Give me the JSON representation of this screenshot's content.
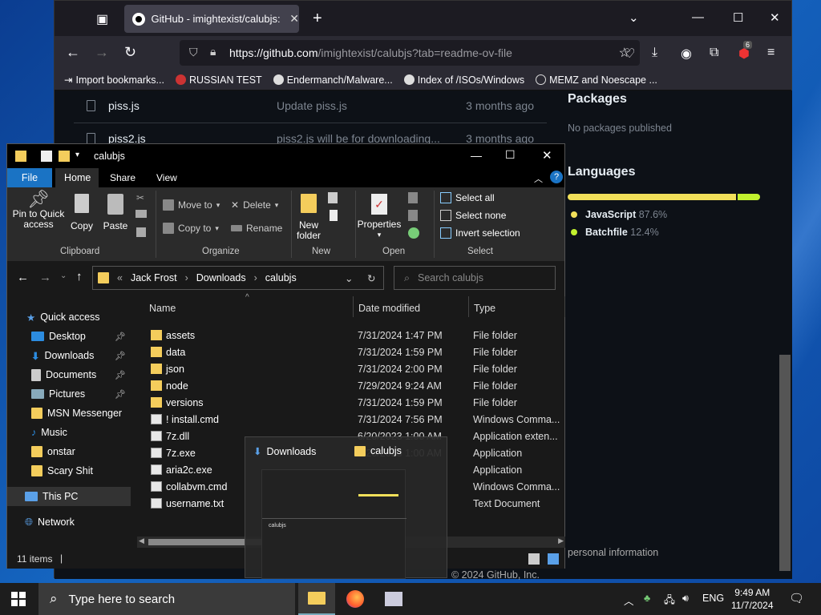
{
  "browser": {
    "tab_title": "GitHub - imightexist/calubjs: th",
    "url_host": "https://github.com",
    "url_path": "/imightexist/calubjs?tab=readme-ov-file",
    "ext_badge": "6",
    "bookmarks": [
      "Import bookmarks...",
      "RUSSIAN TEST",
      "Endermanch/Malware...",
      "Index of /ISOs/Windows",
      "MEMZ and Noescape ..."
    ]
  },
  "github": {
    "rows": [
      {
        "name": "piss.js",
        "msg": "Update piss.js",
        "time": "3 months ago"
      },
      {
        "name": "piss2.js",
        "msg": "piss2.js will be for downloading...",
        "time": "3 months ago"
      }
    ],
    "packages_title": "Packages",
    "packages_text": "No packages published",
    "languages_title": "Languages",
    "languages": [
      {
        "name": "JavaScript",
        "pct": "87.6%",
        "color": "#f1e05a"
      },
      {
        "name": "Batchfile",
        "pct": "12.4%",
        "color": "#c1f12e"
      }
    ],
    "footer_text": "personal information",
    "footer_text2": "© 2024 GitHub, Inc."
  },
  "explorer": {
    "title": "calubjs",
    "menu": {
      "file": "File",
      "home": "Home",
      "share": "Share",
      "view": "View"
    },
    "ribbon": {
      "pin": "Pin to Quick access",
      "pin1": "Pin to Quick",
      "pin2": "access",
      "copy": "Copy",
      "paste": "Paste",
      "clipboard": "Clipboard",
      "move_to": "Move to",
      "copy_to": "Copy to",
      "delete": "Delete",
      "rename": "Rename",
      "organize": "Organize",
      "new_folder1": "New",
      "new_folder2": "folder",
      "new": "New",
      "properties": "Properties",
      "open": "Open",
      "select_all": "Select all",
      "select_none": "Select none",
      "invert": "Invert selection",
      "select": "Select"
    },
    "breadcrumb": [
      "Jack Frost",
      "Downloads",
      "calubjs"
    ],
    "search_placeholder": "Search calubjs",
    "nav": [
      {
        "label": "Quick access",
        "pin": false
      },
      {
        "label": "Desktop",
        "pin": true
      },
      {
        "label": "Downloads",
        "pin": true
      },
      {
        "label": "Documents",
        "pin": true
      },
      {
        "label": "Pictures",
        "pin": true
      },
      {
        "label": "MSN Messenger",
        "pin": false
      },
      {
        "label": "Music",
        "pin": false
      },
      {
        "label": "onstar",
        "pin": false
      },
      {
        "label": "Scary Shit",
        "pin": false
      },
      {
        "label": "This PC",
        "pin": false
      },
      {
        "label": "Network",
        "pin": false
      }
    ],
    "columns": {
      "name": "Name",
      "date": "Date modified",
      "type": "Type"
    },
    "files": [
      {
        "name": "assets",
        "date": "7/31/2024 1:47 PM",
        "type": "File folder",
        "kind": "folder"
      },
      {
        "name": "data",
        "date": "7/31/2024 1:59 PM",
        "type": "File folder",
        "kind": "folder"
      },
      {
        "name": "json",
        "date": "7/31/2024 2:00 PM",
        "type": "File folder",
        "kind": "folder"
      },
      {
        "name": "node",
        "date": "7/29/2024 9:24 AM",
        "type": "File folder",
        "kind": "folder"
      },
      {
        "name": "versions",
        "date": "7/31/2024 1:59 PM",
        "type": "File folder",
        "kind": "folder"
      },
      {
        "name": "! install.cmd",
        "date": "7/31/2024 7:56 PM",
        "type": "Windows Comma...",
        "kind": "cmd"
      },
      {
        "name": "7z.dll",
        "date": "6/20/2023 1:00 AM",
        "type": "Application exten...",
        "kind": "dll"
      },
      {
        "name": "7z.exe",
        "date": "6/20/2023 1:00 AM",
        "type": "Application",
        "kind": "exe"
      },
      {
        "name": "aria2c.exe",
        "date": "",
        "type": "Application",
        "kind": "exe"
      },
      {
        "name": "collabvm.cmd",
        "date": "",
        "type": "Windows Comma...",
        "kind": "cmd"
      },
      {
        "name": "username.txt",
        "date": "",
        "type": "Text Document",
        "kind": "txt"
      }
    ],
    "status": "11 items"
  },
  "drag_preview": {
    "left": "Downloads",
    "right": "calubjs",
    "inner_title": "calubjs"
  },
  "taskbar": {
    "search_placeholder": "Type here to search",
    "lang": "ENG",
    "time": "9:49 AM",
    "date": "11/7/2024"
  }
}
